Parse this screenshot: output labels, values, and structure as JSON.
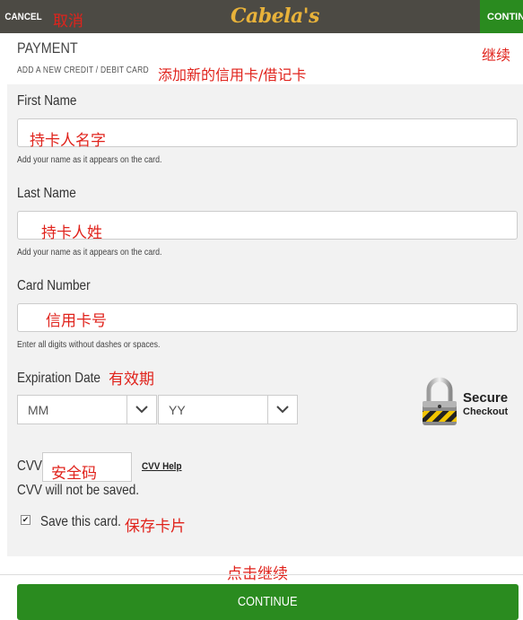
{
  "topbar": {
    "cancel_label": "CANCEL",
    "cancel_cn": "取消",
    "logo": "Cabela's",
    "continue_label": "CONTINUE"
  },
  "header": {
    "title": "PAYMENT",
    "continue_cn": "继续",
    "subtitle": "ADD A NEW CREDIT / DEBIT CARD",
    "subtitle_cn": "添加新的信用卡/借记卡"
  },
  "form": {
    "first_name": {
      "label": "First Name",
      "value_cn": "持卡人名字",
      "hint": "Add your name as it appears on the card."
    },
    "last_name": {
      "label": "Last Name",
      "value_cn": "持卡人姓",
      "hint": "Add your name as it appears on the card."
    },
    "card_number": {
      "label": "Card Number",
      "value_cn": "信用卡号",
      "hint": "Enter all digits without dashes or spaces."
    },
    "expiration": {
      "label": "Expiration Date",
      "label_cn": "有效期",
      "month_value": "MM",
      "year_value": "YY"
    },
    "cvv": {
      "label": "CVV",
      "value_cn": "安全码",
      "help_link": "CVV Help",
      "note": "CVV will not be saved."
    },
    "save_card": {
      "label": "Save this card.",
      "label_cn": "保存卡片",
      "checked": true
    }
  },
  "secure_badge": {
    "title": "Secure",
    "subtitle": "Checkout"
  },
  "footer": {
    "continue_cn": "点击继续",
    "continue_label": "CONTINUE"
  },
  "colors": {
    "topbar": "#4c4a44",
    "brand_gold": "#e8b23a",
    "continue_green": "#2a8b1f",
    "annotation_red": "#e0231c"
  }
}
